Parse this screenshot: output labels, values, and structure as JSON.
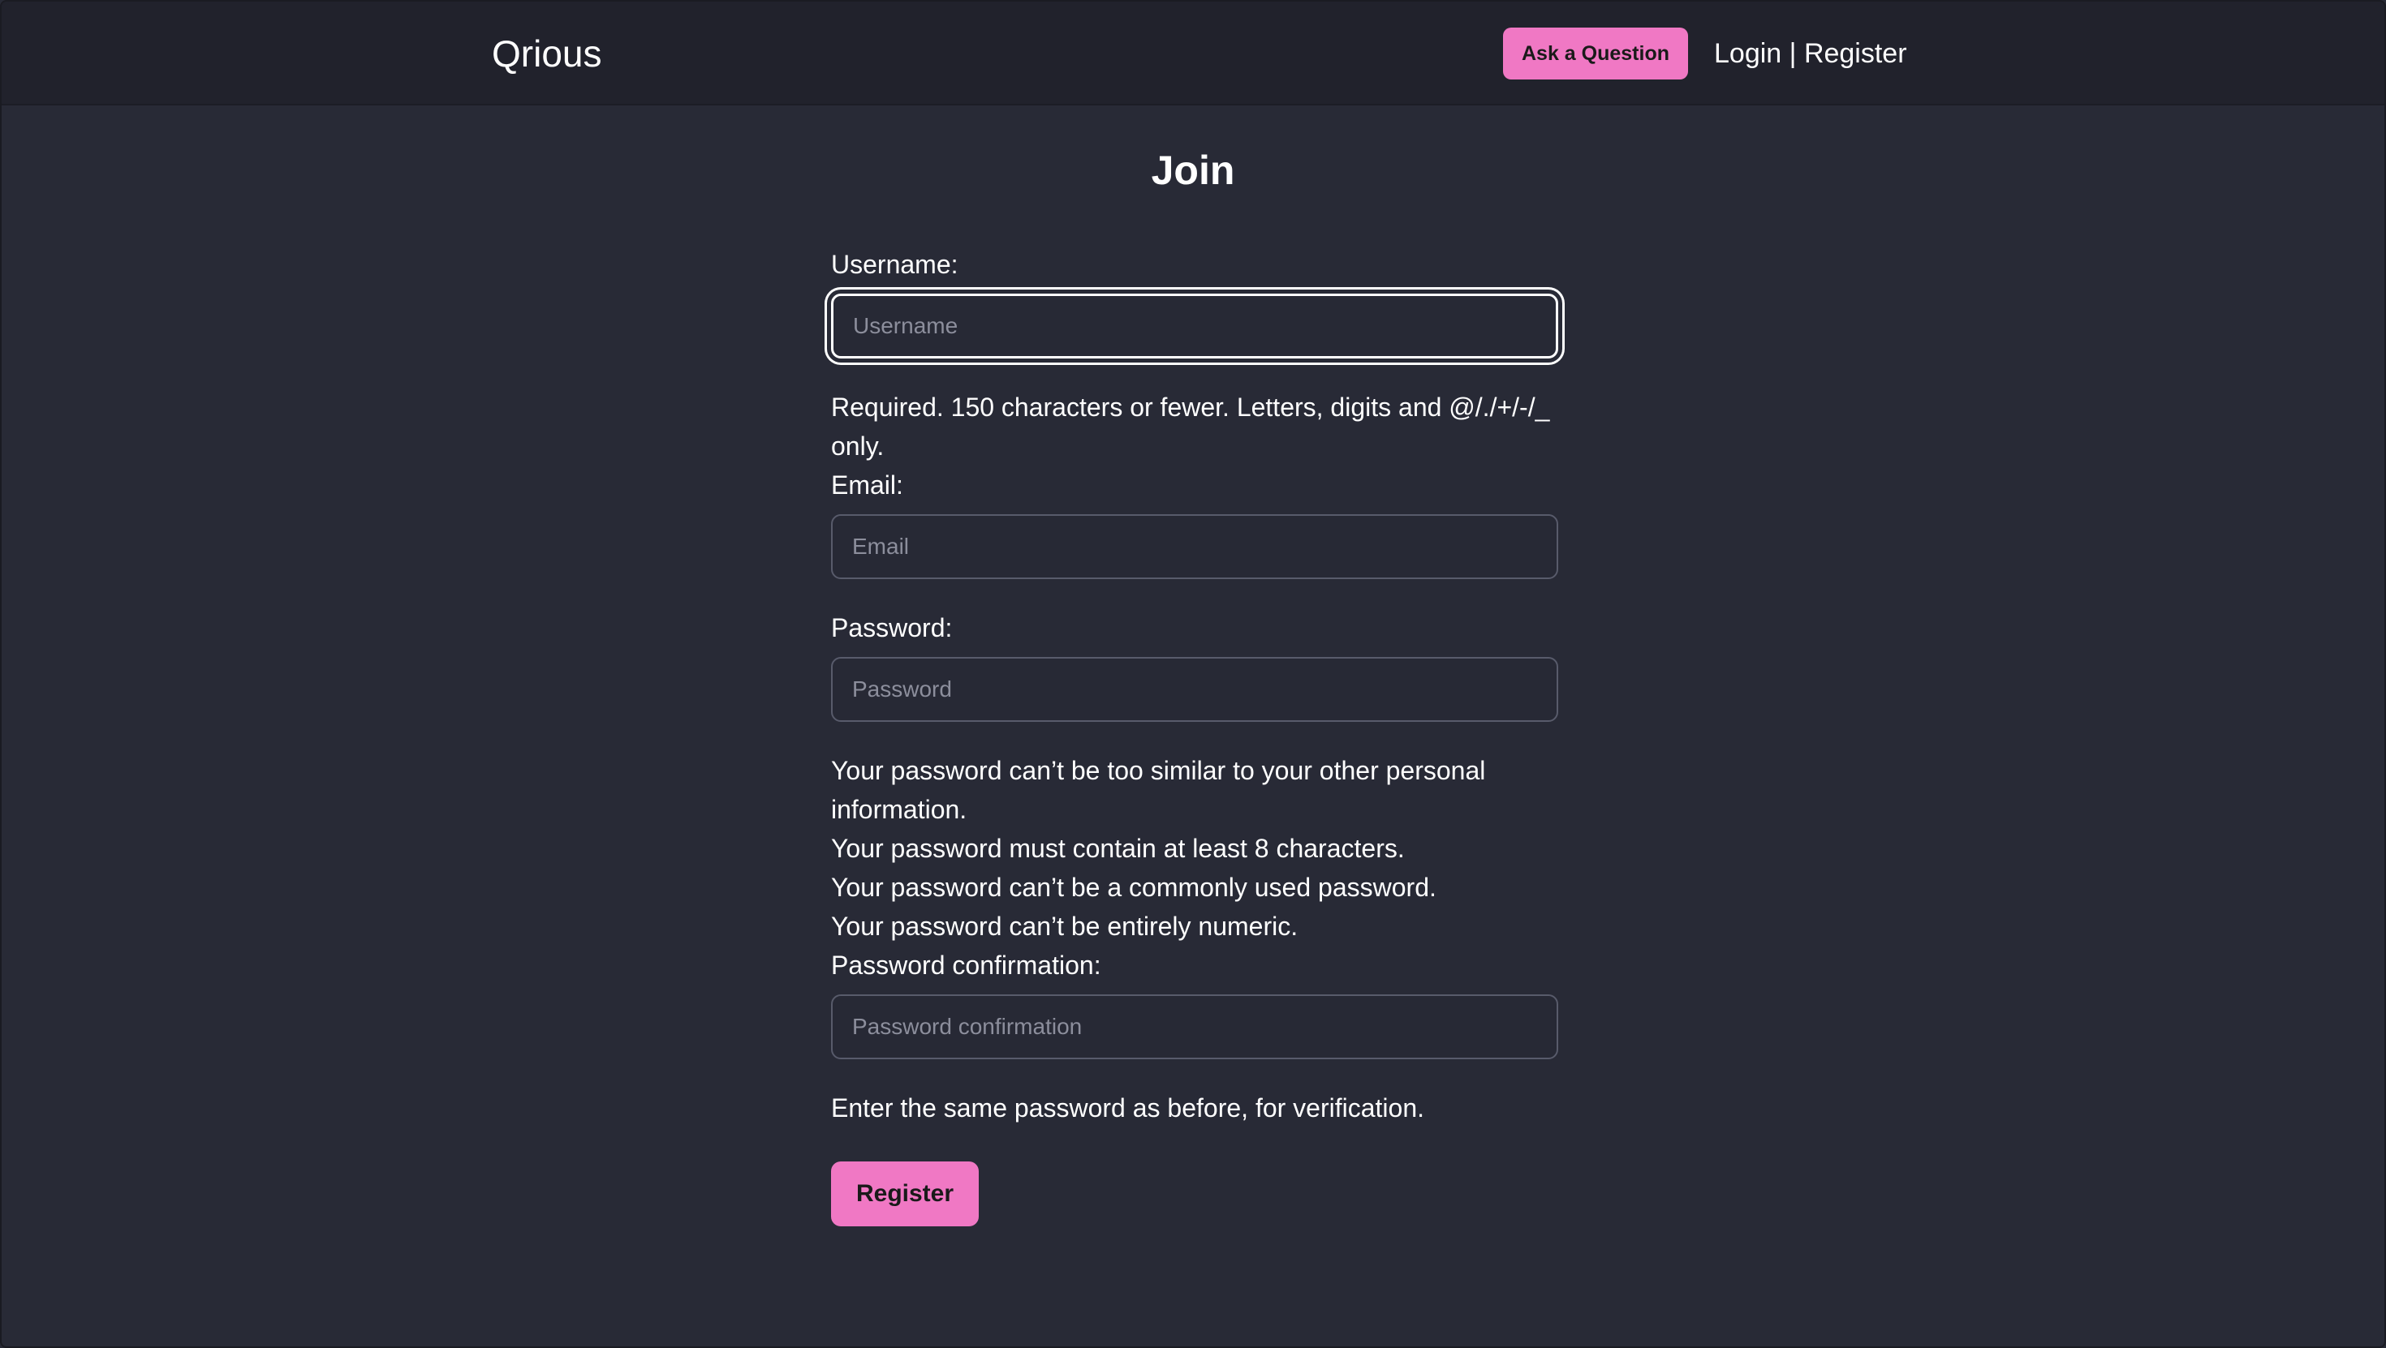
{
  "navbar": {
    "brand": "Qrious",
    "ask_button": "Ask a Question",
    "login_link": "Login",
    "separator": " | ",
    "register_link": "Register"
  },
  "page": {
    "title": "Join"
  },
  "form": {
    "username": {
      "label": "Username:",
      "placeholder": "Username",
      "value": "",
      "help": "Required. 150 characters or fewer. Letters, digits and @/./+/-/_ only."
    },
    "email": {
      "label": "Email:",
      "placeholder": "Email",
      "value": ""
    },
    "password": {
      "label": "Password:",
      "placeholder": "Password",
      "value": "",
      "help": [
        "Your password can’t be too similar to your other personal information.",
        "Your password must contain at least 8 characters.",
        "Your password can’t be a commonly used password.",
        "Your password can’t be entirely numeric."
      ]
    },
    "password_confirmation": {
      "label": "Password confirmation:",
      "placeholder": "Password confirmation",
      "value": "",
      "help": "Enter the same password as before, for verification."
    },
    "submit_label": "Register"
  },
  "colors": {
    "background": "#282a36",
    "navbar": "#21222c",
    "accent": "#f078c4",
    "input_border": "#585b6b",
    "placeholder": "#8c8e9c"
  }
}
